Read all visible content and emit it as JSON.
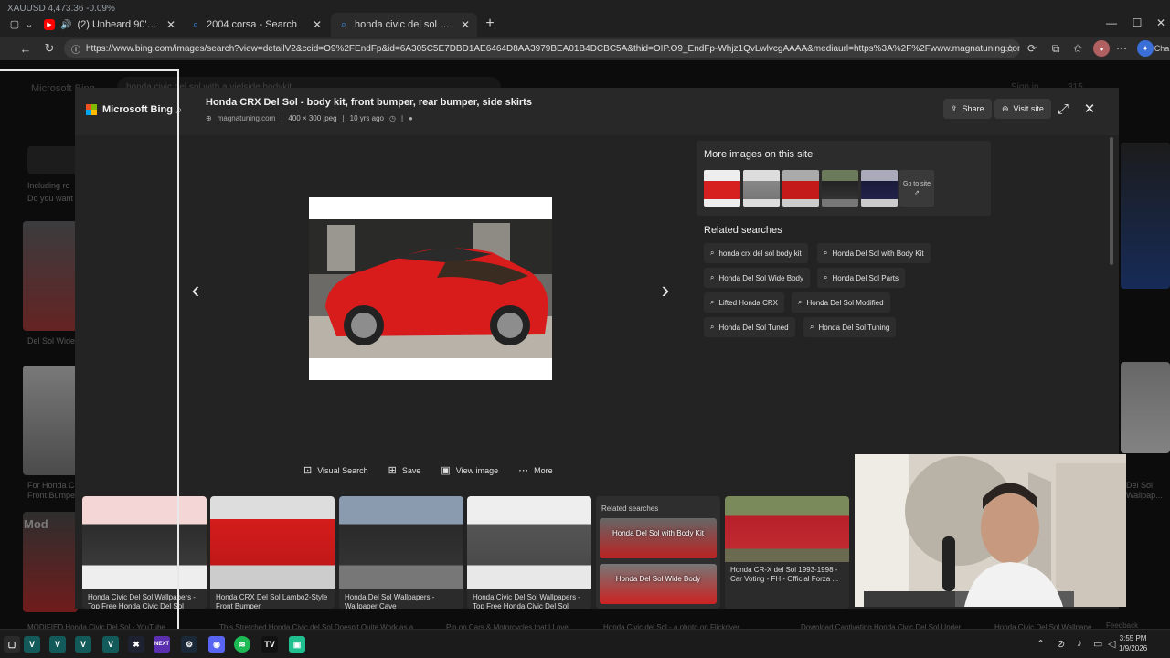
{
  "browser": {
    "ticker": "XAUUSD  4,473.36  -0.09%",
    "tabs": [
      {
        "title": "(2) Unheard 90's Hip Hop Mix"
      },
      {
        "title": "2004 corsa - Search"
      },
      {
        "title": "honda civic del sol with a vielside"
      }
    ],
    "url": "https://www.bing.com/images/search?view=detailV2&ccid=O9%2FEndFp&id=6A305C5E7DBD1AE6464D8AA3979BEA01B4DCBC5A&thid=OIP.O9_EndFp-Whjz1QvLwlvcgAAAA&mediaurl=https%3A%2F%2Fwww.magnatuning.com%2Fimages%...",
    "chat_label": "Cha"
  },
  "background": {
    "logo": "Microsoft Bing",
    "query": "honda civic del sol with a vielside bodykit",
    "sign_in": "Sign in",
    "rewards": "315",
    "including": "Including re",
    "do_you_want": "Do you want",
    "captions": [
      "Del Sol Wide",
      "For Honda Civ",
      "Front Bumper",
      "Del Sol",
      "Wallpap..."
    ],
    "mod_text": "Mod",
    "bottom": [
      "MODIFIED Honda Civic Del Sol - YouTube",
      "This Stretched Honda Civic del Sol Doesn't Quite Work as a",
      "Pin on Cars & Motorcycles that I Love",
      "Honda Civic del Sol - a photo on Flickriver",
      "Download Captivating Honda Civic Del Sol Under",
      "Honda Civic Del Sol Wallpape"
    ],
    "feedback": "Feedback"
  },
  "modal": {
    "brand": "Microsoft Bing",
    "title": "Honda CRX Del Sol - body kit, front bumper, rear bumper, side skirts",
    "domain": "magnatuning.com",
    "size": "400 × 300 jpeg",
    "age": "10 yrs ago",
    "share": "Share",
    "visit": "Visit site",
    "more_images_heading": "More images on this site",
    "go_to_site": "Go to site",
    "related_heading": "Related searches",
    "related": [
      "honda crx del sol body kit",
      "Honda Del Sol with Body Kit",
      "Honda Del Sol Wide Body",
      "Honda Del Sol Parts",
      "Lifted Honda CRX",
      "Honda Del Sol Modified",
      "Honda Del Sol Tuned",
      "Honda Del Sol Tuning"
    ],
    "actions": [
      "Visual Search",
      "Save",
      "View image",
      "More"
    ],
    "film": [
      "Honda Civic Del Sol Wallpapers - Top Free Honda Civic Del Sol",
      "Honda CRX Del Sol Lambo2-Style Front Bumper",
      "Honda Del Sol Wallpapers - Wallpaper Cave",
      "Honda Civic Del Sol Wallpapers - Top Free Honda Civic Del Sol",
      "Honda CR-X del Sol 1993-1998 - Car Voting - FH - Official Forza ..."
    ],
    "related_cards": [
      "Honda Del Sol with Body Kit",
      "Honda Del Sol Wide Body"
    ]
  },
  "taskbar": {
    "time": "3:55 PM",
    "date": "1/9/2026"
  }
}
